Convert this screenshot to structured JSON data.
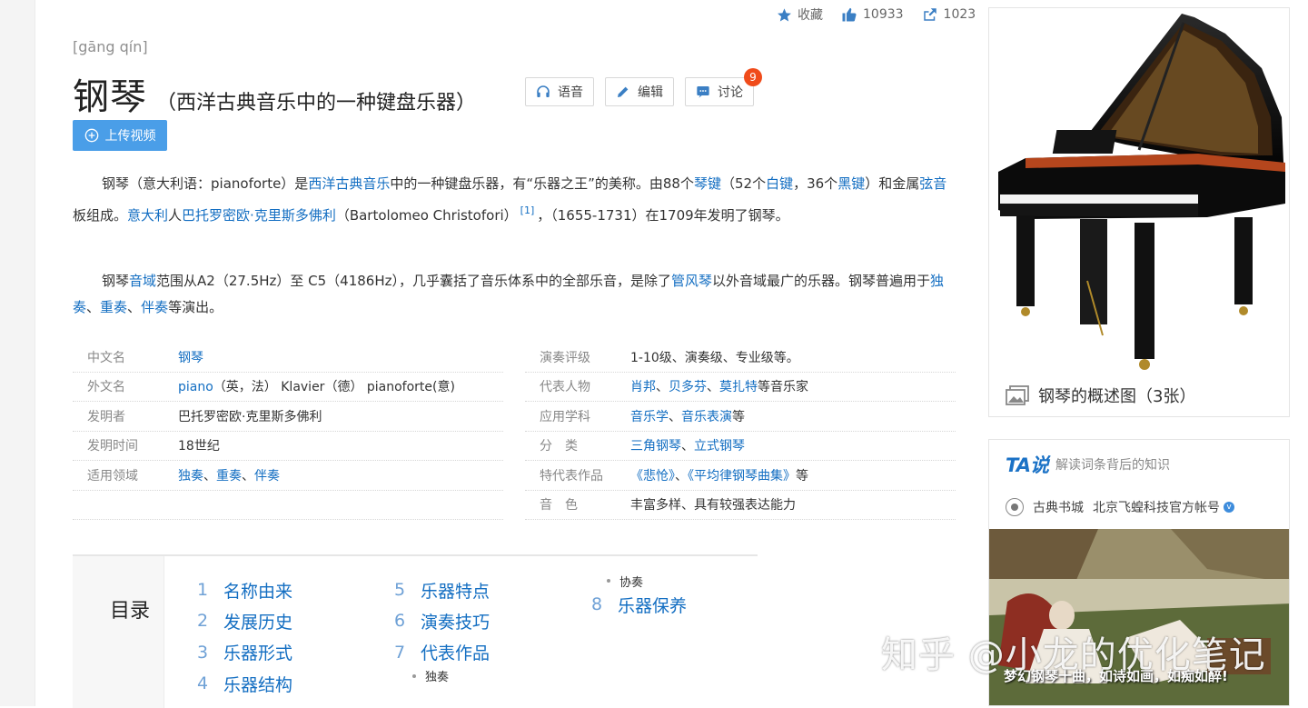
{
  "topbar": {
    "favorite": "收藏",
    "likes": "10933",
    "shares": "1023"
  },
  "entry": {
    "pinyin": "[gāng qín]",
    "title": "钢琴",
    "subtitle": "（西洋古典音乐中的一种键盘乐器）"
  },
  "buttons": {
    "voice": "语音",
    "edit": "编辑",
    "discuss": "讨论",
    "discuss_count": "9",
    "upload": "上传视频"
  },
  "para1": {
    "t1": "钢琴（意大利语：pianoforte）是",
    "l1": "西洋古典音乐",
    "t2": "中的一种键盘乐器，有“乐器之王”的美称。由88个",
    "l2": "琴键",
    "t3": "（52个",
    "l3": "白键",
    "t4": "，36个",
    "l4": "黑键",
    "t5": "）和金属",
    "l5": "弦音",
    "t6": "板组成。",
    "l6": "意大利",
    "t7": "人",
    "l7": "巴托罗密欧·克里斯多佛利",
    "t8": "（Bartolomeo Christofori）",
    "ref": "[1]",
    "t9": "，（1655-1731）在1709年发明了钢琴。"
  },
  "para2": {
    "t1": "钢琴",
    "l1": "音域",
    "t2": "范围从A2（27.5Hz）至 C5（4186Hz），几乎囊括了音乐体系中的全部乐音，是除了",
    "l2": "管风琴",
    "t3": "以外音域最广的乐器。钢琴普遍用于",
    "l3": "独奏",
    "s1": "、",
    "l4": "重奏",
    "s2": "、",
    "l5": "伴奏",
    "t4": "等演出。"
  },
  "info_left": [
    {
      "k": "中文名",
      "link": "钢琴"
    },
    {
      "k": "外文名",
      "link": "piano",
      "v": "（英，法） Klavier（德） pianoforte(意)"
    },
    {
      "k": "发明者",
      "v": "巴托罗密欧·克里斯多佛利"
    },
    {
      "k": "发明时间",
      "v": "18世纪"
    },
    {
      "k": "适用领域",
      "l1": "独奏",
      "s1": "、",
      "l2": "重奏",
      "s2": "、",
      "l3": "伴奏"
    }
  ],
  "info_right": [
    {
      "k": "演奏评级",
      "v": "1-10级、演奏级、专业级等。"
    },
    {
      "k": "代表人物",
      "l1": "肖邦",
      "s1": "、",
      "l2": "贝多芬",
      "s2": "、",
      "l3": "莫扎特",
      "t": "等音乐家"
    },
    {
      "k": "应用学科",
      "l1": "音乐学",
      "s1": "、",
      "l2": "音乐表演",
      "t": "等"
    },
    {
      "k": "分　类",
      "l1": "三角钢琴",
      "s1": "、",
      "l2": "立式钢琴"
    },
    {
      "k": "特代表作品",
      "l1": "《悲怆》",
      "s1": "、",
      "l2": "《平均律钢琴曲集》",
      "t": "等"
    },
    {
      "k": "音　色",
      "v": "丰富多样、具有较强表达能力"
    }
  ],
  "toc": {
    "label": "目录",
    "col1": [
      {
        "n": "1",
        "t": "名称由来"
      },
      {
        "n": "2",
        "t": "发展历史"
      },
      {
        "n": "3",
        "t": "乐器形式"
      },
      {
        "n": "4",
        "t": "乐器结构"
      }
    ],
    "col2": [
      {
        "n": "5",
        "t": "乐器特点"
      },
      {
        "n": "6",
        "t": "演奏技巧"
      },
      {
        "n": "7",
        "t": "代表作品"
      }
    ],
    "col2_sub": "独奏",
    "col3_sub": "协奏",
    "col3": [
      {
        "n": "8",
        "t": "乐器保养"
      }
    ]
  },
  "sidebar": {
    "image_caption": "钢琴的概述图（3张）",
    "ta_logo": "TA说",
    "ta_slogan": "解读词条背后的知识",
    "ta_author": "古典书城",
    "ta_org": "北京飞蝗科技官方帐号",
    "ta_verified": "v",
    "ta_image_text": "梦幻钢琴十曲，如诗如画，如痴如醉!"
  },
  "watermark": "知乎 @小龙的优化笔记",
  "colors": {
    "link": "#136ec2",
    "upload_btn": "#4a9ee8",
    "badge": "#f04b1a"
  }
}
